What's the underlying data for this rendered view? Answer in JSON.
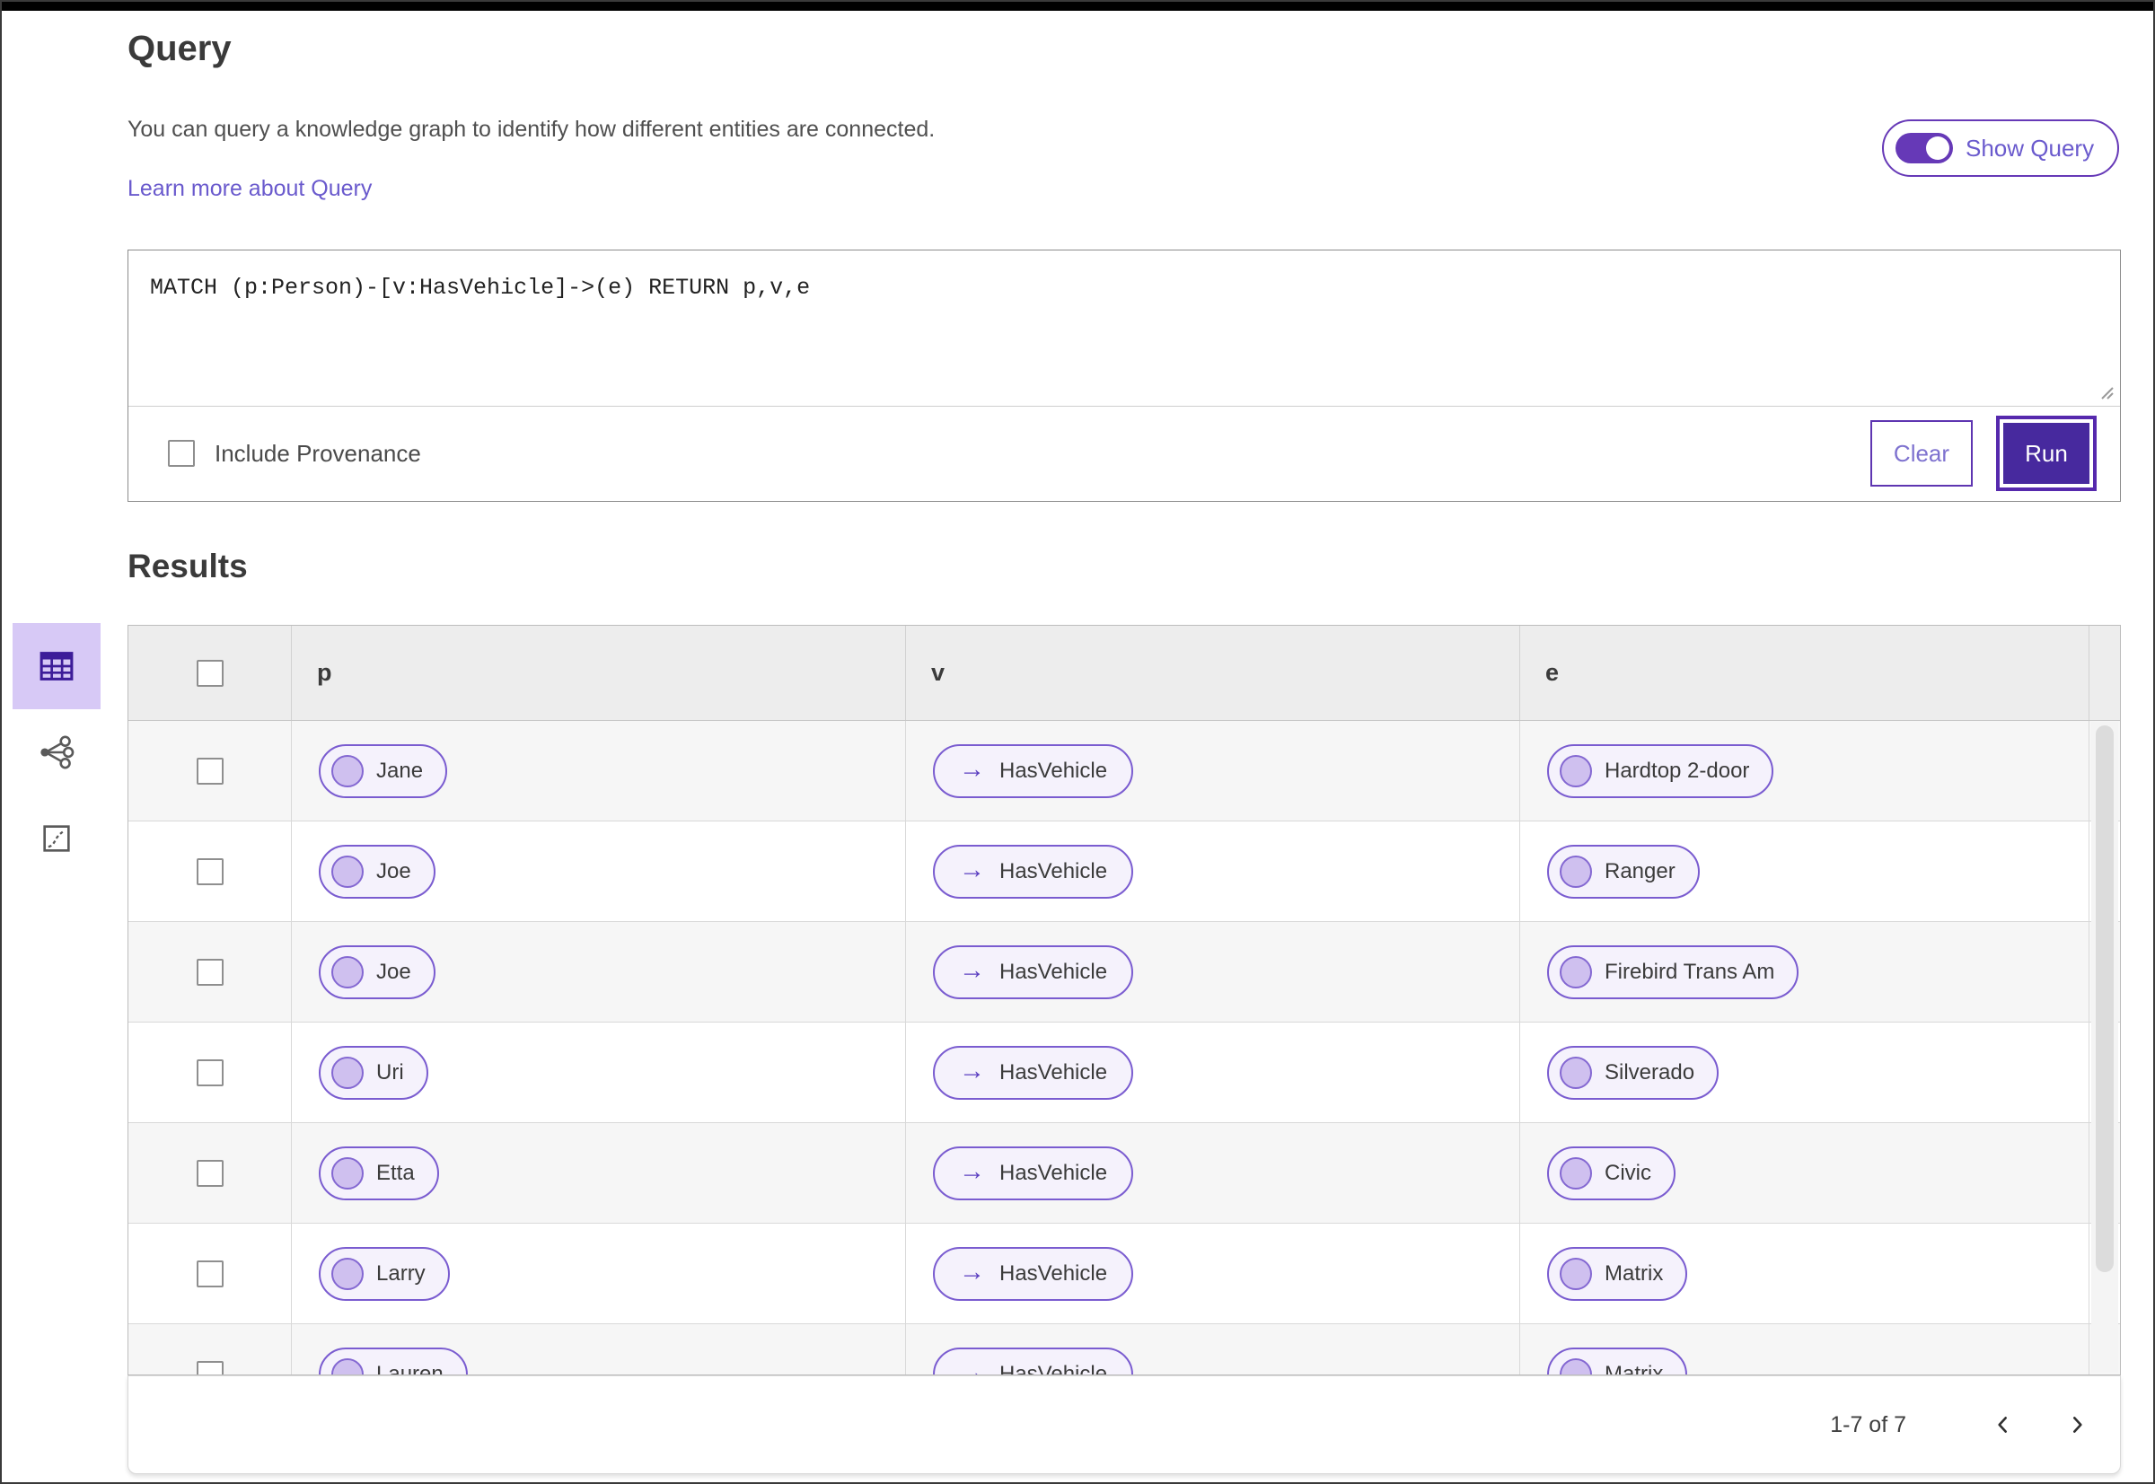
{
  "header": {
    "title": "Query",
    "description": "You can query a knowledge graph to identify how different entities are connected.",
    "learn_more_link": "Learn more about Query",
    "show_query_toggle": {
      "label": "Show Query",
      "state": "on"
    }
  },
  "query_editor": {
    "query_text": "MATCH (p:Person)-[v:HasVehicle]->(e) RETURN p,v,e",
    "include_provenance_label": "Include Provenance",
    "include_provenance_checked": false,
    "clear_button_label": "Clear",
    "run_button_label": "Run"
  },
  "results": {
    "title": "Results",
    "view_switcher": [
      {
        "name": "table-view",
        "icon": "table-icon",
        "selected": true
      },
      {
        "name": "graph-view",
        "icon": "graph-nodes-icon",
        "selected": false
      },
      {
        "name": "chart-view",
        "icon": "chart-icon",
        "selected": false
      }
    ],
    "table": {
      "columns": [
        "p",
        "v",
        "e"
      ],
      "edge_arrow": "→",
      "rows": [
        {
          "p": "Jane",
          "v": "HasVehicle",
          "e": "Hardtop 2-door"
        },
        {
          "p": "Joe",
          "v": "HasVehicle",
          "e": "Ranger"
        },
        {
          "p": "Joe",
          "v": "HasVehicle",
          "e": "Firebird Trans Am"
        },
        {
          "p": "Uri",
          "v": "HasVehicle",
          "e": "Silverado"
        },
        {
          "p": "Etta",
          "v": "HasVehicle",
          "e": "Civic"
        },
        {
          "p": "Larry",
          "v": "HasVehicle",
          "e": "Matrix"
        },
        {
          "p": "Lauren",
          "v": "HasVehicle",
          "e": "Matrix"
        }
      ]
    },
    "pagination": {
      "range_label": "1-7 of 7"
    }
  },
  "colors": {
    "accent_deep_purple": "#47299e",
    "accent_purple": "#5e35b1",
    "toggle_purple": "#6639b7",
    "link_purple": "#6a5acd",
    "pill_border": "#7a5cd0",
    "pill_bg": "#f5f2fc",
    "pill_circle": "#cfc0ef",
    "selected_view_bg": "#d7c9f6",
    "table_header_bg": "#ededed",
    "row_alt_bg": "#f6f6f6"
  }
}
